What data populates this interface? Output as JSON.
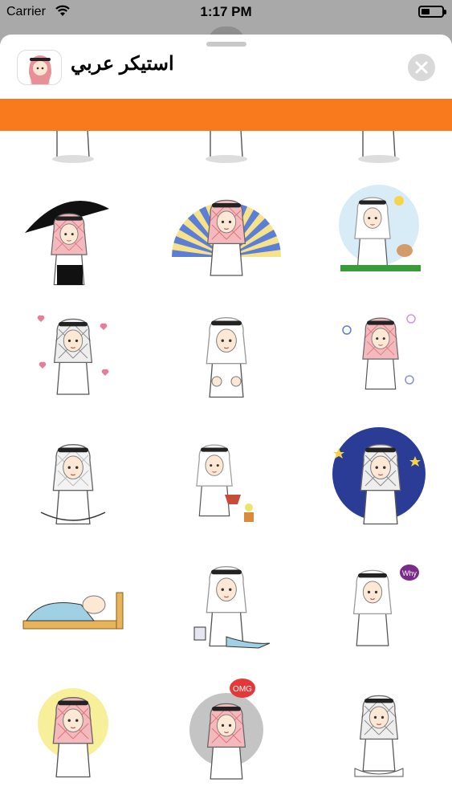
{
  "status": {
    "carrier": "Carrier",
    "time": "1:17 PM",
    "battery_level": 0.35
  },
  "sheet": {
    "title": "استيكر عربي",
    "app_icon": "sticker-app-icon",
    "close_icon": "close-icon"
  },
  "banner": {
    "color": "#f97a1d"
  },
  "stickers": [
    {
      "name": "sticker-standing",
      "variant": "partial"
    },
    {
      "name": "sticker-walking",
      "variant": "partial"
    },
    {
      "name": "sticker-soccer",
      "variant": "partial"
    },
    {
      "name": "sticker-umbrella",
      "variant": "umbrella"
    },
    {
      "name": "sticker-sunburst",
      "variant": "sunburst"
    },
    {
      "name": "sticker-sunny-cat",
      "variant": "sunny"
    },
    {
      "name": "sticker-hearts",
      "variant": "hearts"
    },
    {
      "name": "sticker-thumbs-up",
      "variant": "thumbs"
    },
    {
      "name": "sticker-spirals",
      "variant": "spirals"
    },
    {
      "name": "sticker-tired",
      "variant": "tired"
    },
    {
      "name": "sticker-watering",
      "variant": "watering"
    },
    {
      "name": "sticker-night-stars",
      "variant": "night"
    },
    {
      "name": "sticker-bed",
      "variant": "bed"
    },
    {
      "name": "sticker-sad",
      "variant": "sad"
    },
    {
      "name": "sticker-why",
      "variant": "why",
      "text": "Why"
    },
    {
      "name": "sticker-praying",
      "variant": "pray"
    },
    {
      "name": "sticker-omg",
      "variant": "omg",
      "text": "OMG"
    },
    {
      "name": "sticker-sitting",
      "variant": "sit"
    }
  ]
}
